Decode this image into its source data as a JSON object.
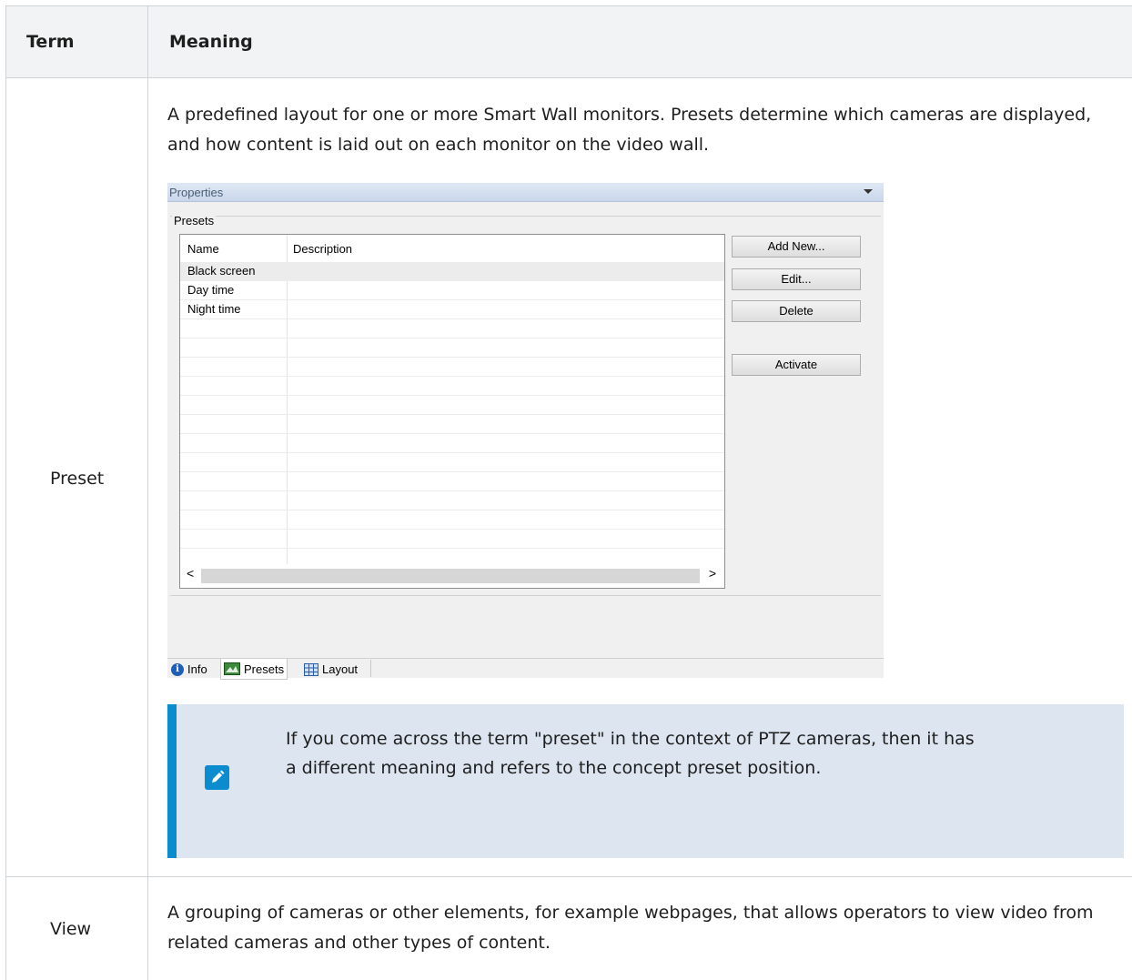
{
  "table": {
    "headers": {
      "term": "Term",
      "meaning": "Meaning"
    },
    "rows": [
      {
        "term": "Preset",
        "meaning": "A predefined layout for one or more Smart Wall monitors. Presets determine which cameras are displayed, and how content is laid out on each monitor on the video wall."
      },
      {
        "term": "View",
        "meaning": "A grouping of cameras or other elements, for example webpages, that allows operators to view video from related cameras and other types of content."
      }
    ]
  },
  "properties_panel": {
    "title": "Properties",
    "group_label": "Presets",
    "columns": [
      "Name",
      "Description"
    ],
    "items": [
      {
        "name": "Black screen",
        "description": "",
        "selected": true
      },
      {
        "name": "Day time",
        "description": ""
      },
      {
        "name": "Night time",
        "description": ""
      }
    ],
    "buttons": {
      "add_new": "Add New...",
      "edit": "Edit...",
      "delete": "Delete",
      "activate": "Activate"
    },
    "scroll_left": "<",
    "scroll_right": ">",
    "tabs": {
      "info": "Info",
      "presets": "Presets",
      "layout": "Layout"
    }
  },
  "note": {
    "text": "If you come across the term \"preset\" in the context of PTZ cameras, then it has a different meaning and refers to the concept preset position."
  },
  "colors": {
    "note_accent": "#0b8ccf",
    "note_background": "#dce5f0",
    "header_background": "#f2f3f4"
  }
}
